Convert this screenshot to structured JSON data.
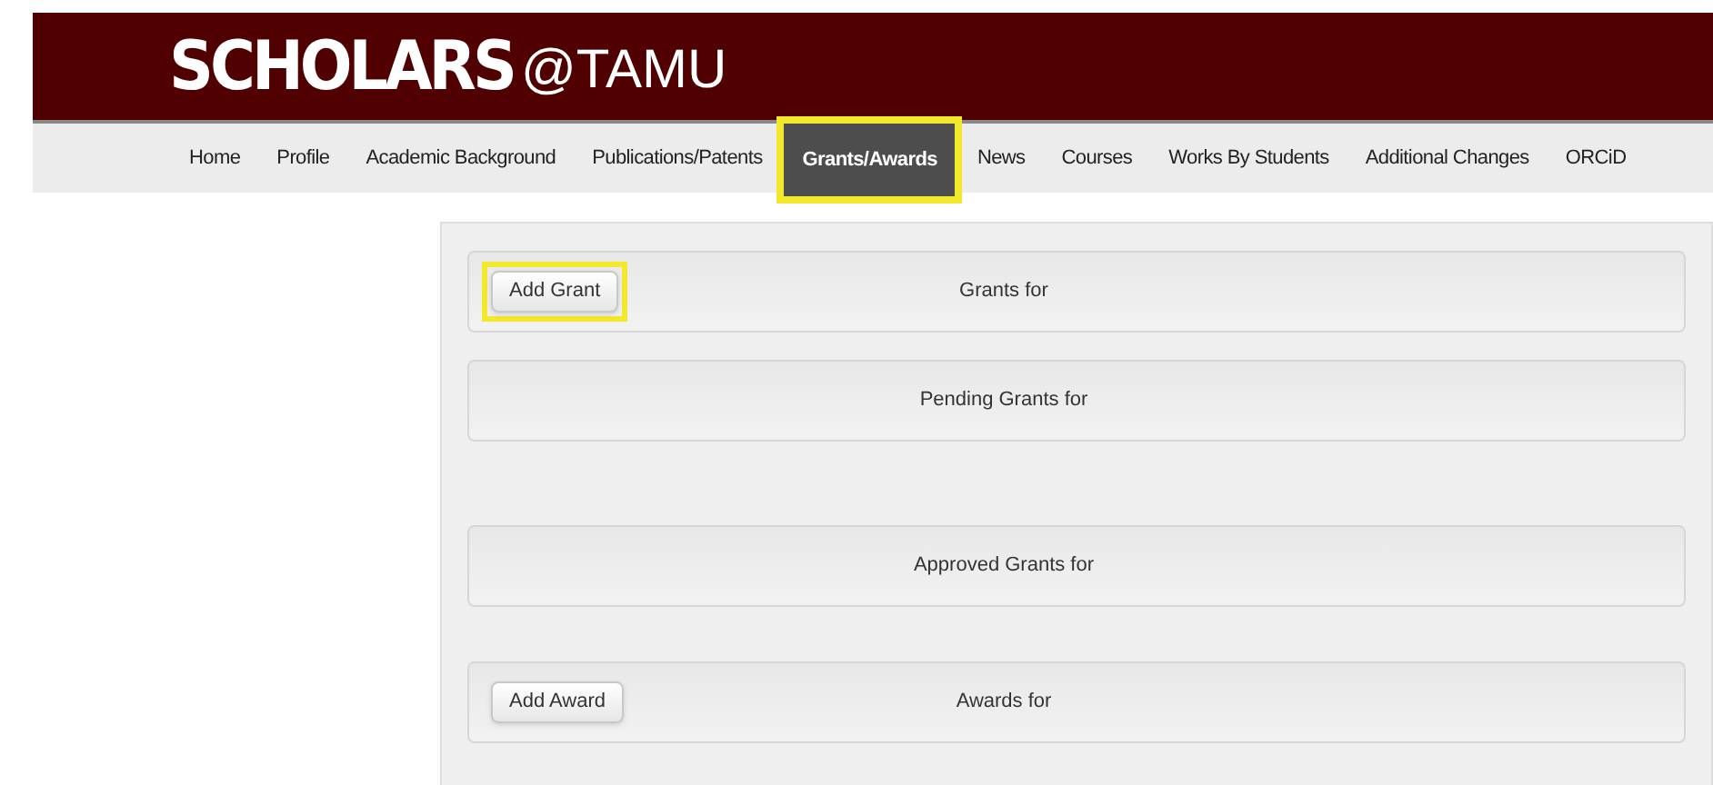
{
  "logo": {
    "brand": "SCHOLARS",
    "suffix": "@TAMU"
  },
  "tabs": [
    {
      "label": "Home",
      "selected": false,
      "highlighted": false
    },
    {
      "label": "Profile",
      "selected": false,
      "highlighted": false
    },
    {
      "label": "Academic Background",
      "selected": false,
      "highlighted": false
    },
    {
      "label": "Publications/Patents",
      "selected": false,
      "highlighted": false
    },
    {
      "label": "Grants/Awards",
      "selected": true,
      "highlighted": true
    },
    {
      "label": "News",
      "selected": false,
      "highlighted": false
    },
    {
      "label": "Courses",
      "selected": false,
      "highlighted": false
    },
    {
      "label": "Works By Students",
      "selected": false,
      "highlighted": false
    },
    {
      "label": "Additional Changes",
      "selected": false,
      "highlighted": false
    },
    {
      "label": "ORCiD",
      "selected": false,
      "highlighted": false
    }
  ],
  "sections": [
    {
      "title": "Grants for",
      "button": {
        "label": "Add Grant",
        "highlighted": true
      }
    },
    {
      "title": "Pending Grants for"
    },
    {
      "title": "Approved Grants for"
    },
    {
      "title": "Awards for",
      "button": {
        "label": "Add Award",
        "highlighted": false
      }
    }
  ]
}
